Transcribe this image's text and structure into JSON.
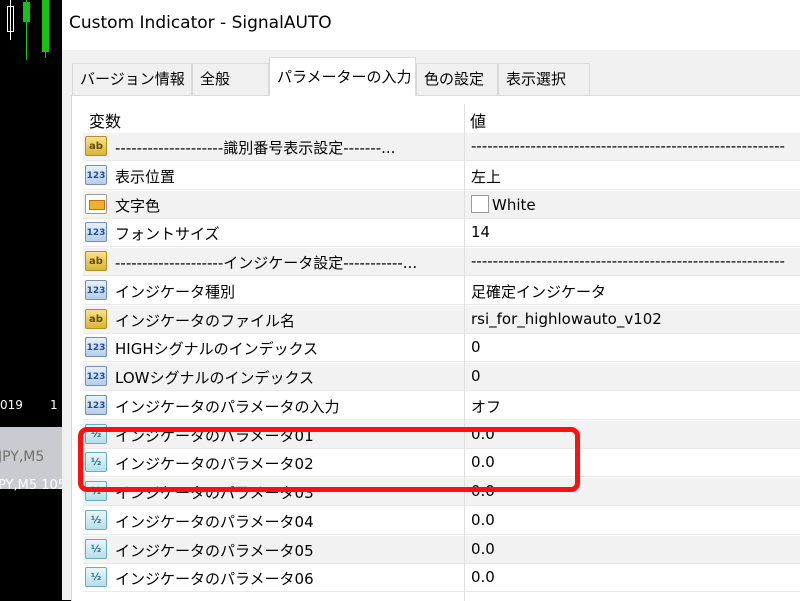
{
  "window": {
    "title": "Custom Indicator - SignalAUTO"
  },
  "background_chart": {
    "date_label": "019",
    "date_label_2": "1",
    "tab_label": "JPY,M5",
    "bottom_label": "PY,M5 105"
  },
  "tabs": [
    {
      "label": "バージョン情報",
      "active": false
    },
    {
      "label": "全般",
      "active": false
    },
    {
      "label": "パラメーターの入力",
      "active": true
    },
    {
      "label": "色の設定",
      "active": false
    },
    {
      "label": "表示選択",
      "active": false
    }
  ],
  "grid": {
    "headers": {
      "variable": "変数",
      "value": "値"
    },
    "rows": [
      {
        "icon": "ab-icon",
        "name": "--------------------識別番号表示設定-------...",
        "value": "----------------------------------------------------------"
      },
      {
        "icon": "123-icon",
        "name": "表示位置",
        "value": "左上"
      },
      {
        "icon": "color-icon",
        "name": "文字色",
        "value": "White"
      },
      {
        "icon": "123-icon",
        "name": "フォントサイズ",
        "value": "14"
      },
      {
        "icon": "ab-icon",
        "name": "--------------------インジケータ設定-----------...",
        "value": "----------------------------------------------------------"
      },
      {
        "icon": "123-icon",
        "name": "インジケータ種別",
        "value": "足確定インジケータ"
      },
      {
        "icon": "ab-icon",
        "name": "インジケータのファイル名",
        "value": "rsi_for_highlowauto_v102"
      },
      {
        "icon": "123-icon",
        "name": "HIGHシグナルのインデックス",
        "value": "0"
      },
      {
        "icon": "123-icon",
        "name": "LOWシグナルのインデックス",
        "value": "0"
      },
      {
        "icon": "123-icon",
        "name": "インジケータのパラメータの入力",
        "value": "オフ"
      },
      {
        "icon": "half-icon",
        "name": "インジケータのパラメータ01",
        "value": "0.0"
      },
      {
        "icon": "half-icon",
        "name": "インジケータのパラメータ02",
        "value": "0.0"
      },
      {
        "icon": "half-icon",
        "name": "インジケータのパラメータ03",
        "value": "0.0"
      },
      {
        "icon": "half-icon",
        "name": "インジケータのパラメータ04",
        "value": "0.0"
      },
      {
        "icon": "half-icon",
        "name": "インジケータのパラメータ05",
        "value": "0.0"
      },
      {
        "icon": "half-icon",
        "name": "インジケータのパラメータ06",
        "value": "0.0"
      }
    ]
  },
  "icons": {
    "ab": "ab",
    "123": "123",
    "half": "½"
  },
  "colors": {
    "highlight": "#ff1010",
    "swatch": "#ffffff"
  }
}
